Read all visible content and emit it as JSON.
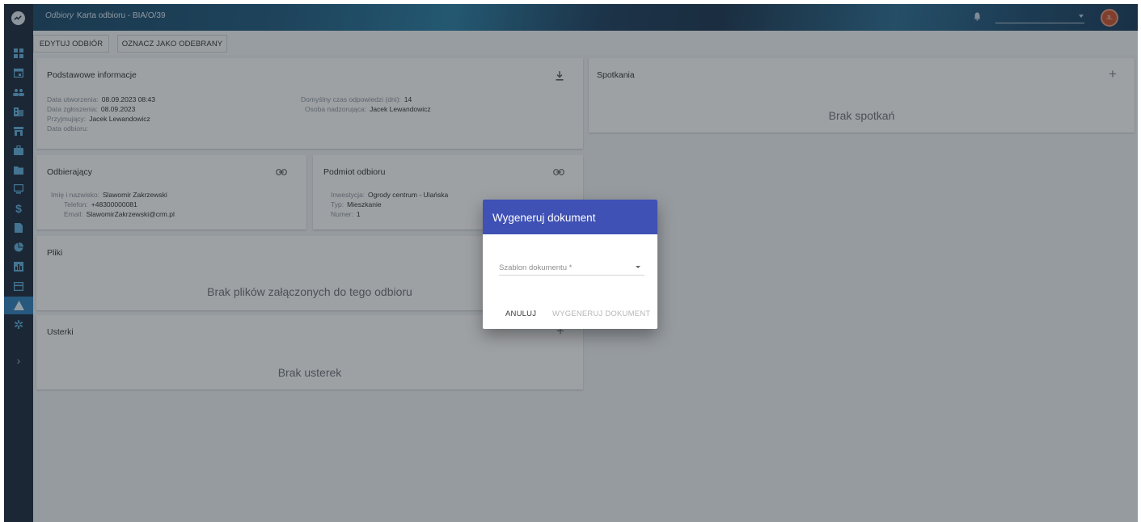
{
  "header": {
    "module": "Odbiory",
    "title": "Karta odbioru - BIA/O/39",
    "user_initials": "JL"
  },
  "toolbar": {
    "edit_label": "EDYTUJ ODBIÓR",
    "mark_label": "OZNACZ JAKO ODEBRANY"
  },
  "basic_info": {
    "title": "Podstawowe informacje",
    "created_key": "Data utworzenia:",
    "created_val": "08.09.2023 08:43",
    "reported_key": "Data zgłoszenia:",
    "reported_val": "08.09.2023",
    "receiver_key": "Przyjmujący:",
    "receiver_val": "Jacek Lewandowicz",
    "pickup_key": "Data odbioru:",
    "pickup_val": "",
    "response_key": "Domyślny czas odpowiedzi (dni):",
    "response_val": "14",
    "supervisor_key": "Osoba nadzorująca:",
    "supervisor_val": "Jacek Lewandowicz"
  },
  "recipient": {
    "title": "Odbierający",
    "name_key": "Imię i nazwisko:",
    "name_val": "Slawomir Zakrzewski",
    "phone_key": "Telefon:",
    "phone_val": "+48300000081",
    "email_key": "Email:",
    "email_val": "SlawomirZakrzewski@crm.pl"
  },
  "subject": {
    "title": "Podmiot odbioru",
    "investment_key": "Inwestycja:",
    "investment_val": "Ogrody centrum - Ulańska",
    "type_key": "Typ:",
    "type_val": "Mieszkanie",
    "number_key": "Numer:",
    "number_val": "1"
  },
  "files": {
    "title": "Pliki",
    "empty": "Brak plików załączonych do tego odbioru"
  },
  "defects": {
    "title": "Usterki",
    "empty": "Brak usterek"
  },
  "meetings": {
    "title": "Spotkania",
    "empty": "Brak spotkań"
  },
  "dialog": {
    "title": "Wygeneruj dokument",
    "field_label": "Szablon dokumentu *",
    "cancel_label": "ANULUJ",
    "generate_label": "WYGENERUJ DOKUMENT"
  },
  "icons": {
    "sidebar": [
      "dashboard-icon",
      "calendar-icon",
      "people-icon",
      "building-icon",
      "store-icon",
      "briefcase-icon",
      "folder-icon",
      "monitor-icon",
      "dollar-icon",
      "document-icon",
      "pie-chart-icon",
      "bar-chart-icon",
      "card-icon",
      "warning-icon",
      "gear-icon",
      "chevron-right-icon"
    ]
  },
  "colors": {
    "dialog_header": "#3f51b5",
    "sidebar": "#1c2a3d",
    "sidebar_active": "#2f7fb8",
    "avatar": "#c9532f"
  }
}
